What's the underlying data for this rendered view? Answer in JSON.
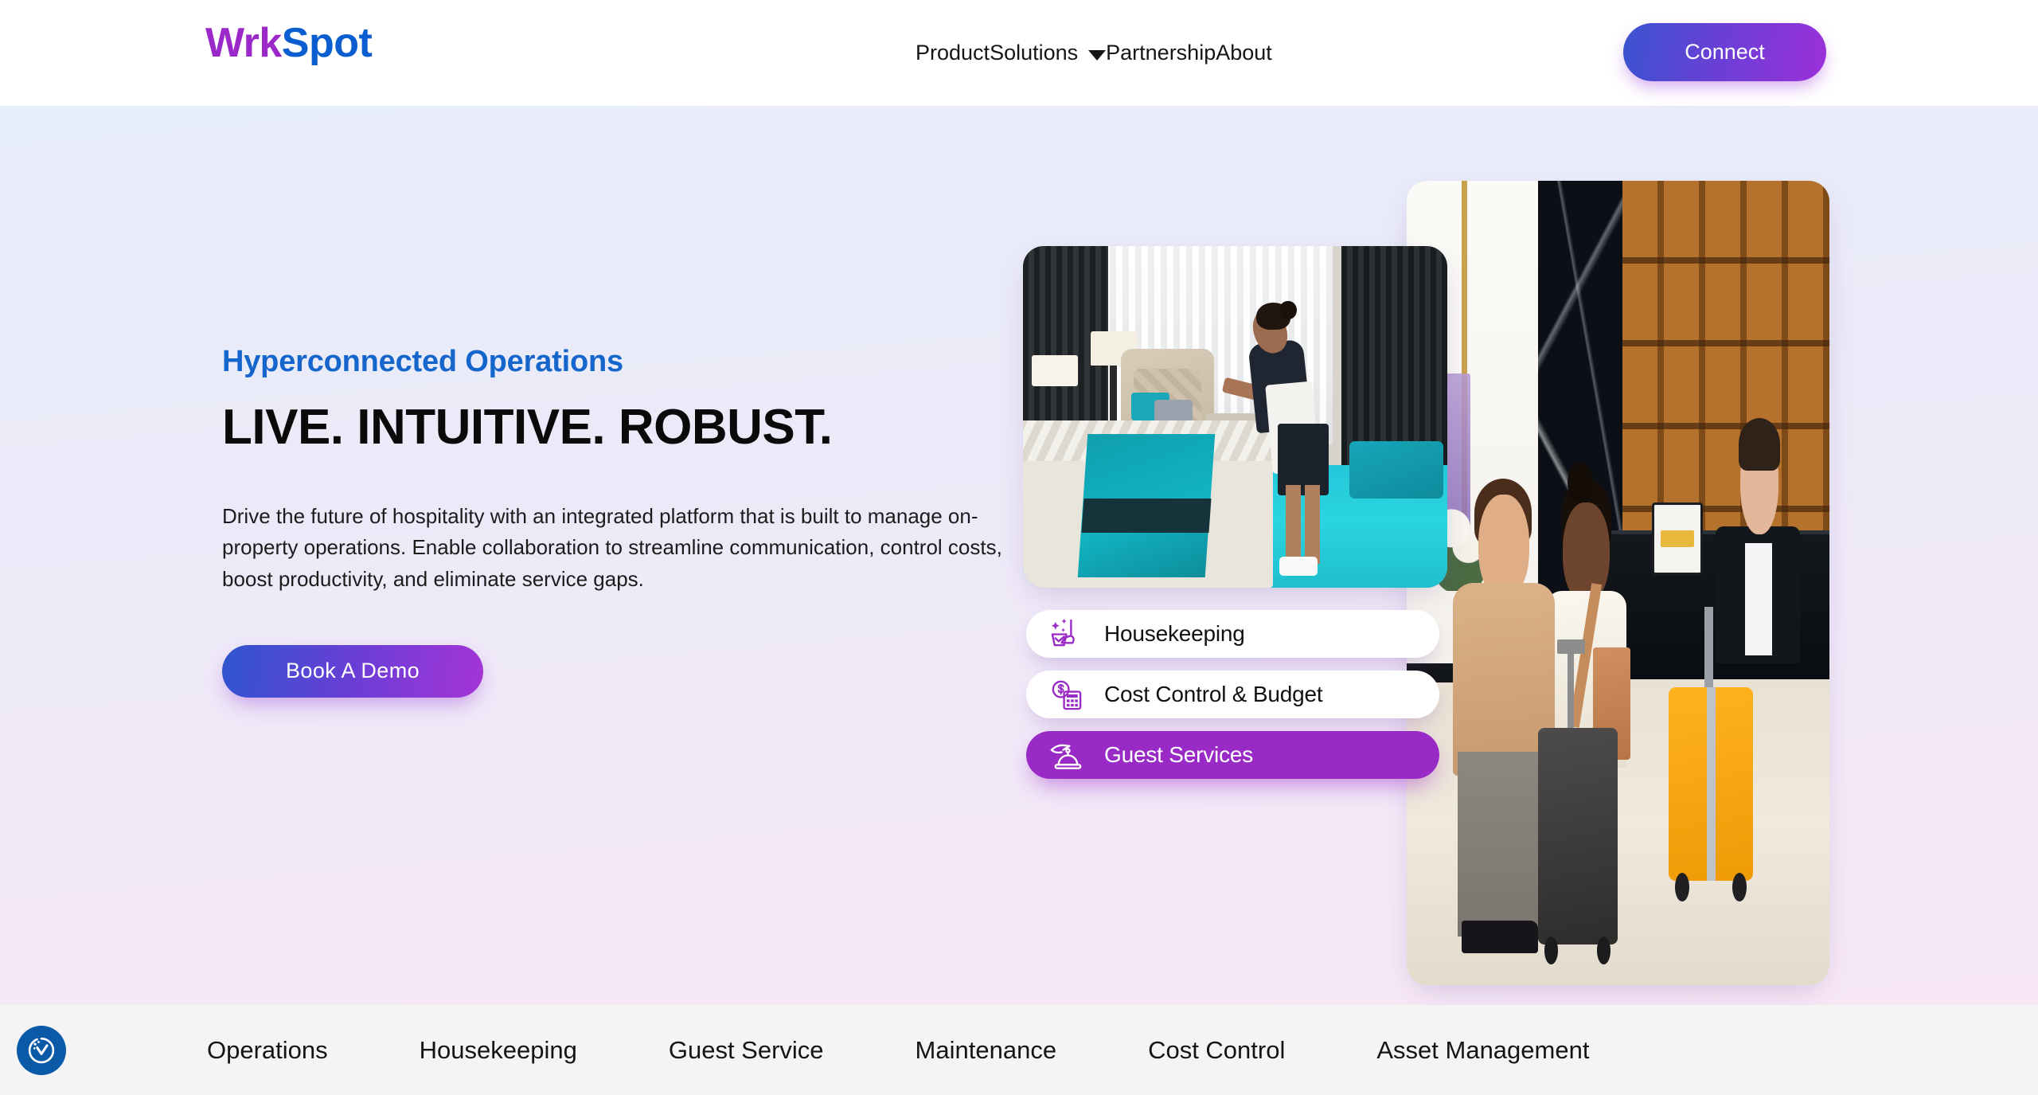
{
  "header": {
    "logo": {
      "part1": "Wrk",
      "part2": "Spot",
      "color1": "#9b28c8",
      "color2": "#0b5ed0"
    },
    "nav": [
      {
        "label": "Product",
        "has_dropdown": false
      },
      {
        "label": "Solutions",
        "has_dropdown": true
      },
      {
        "label": "Partnership",
        "has_dropdown": false
      },
      {
        "label": "About",
        "has_dropdown": false
      }
    ],
    "cta": {
      "label": "Connect",
      "gradient_from": "#3a54d0",
      "gradient_to": "#9b30d9"
    }
  },
  "hero": {
    "eyebrow": "Hyperconnected Operations",
    "eyebrow_color": "#1566cc",
    "headline": "LIVE. INTUITIVE. ROBUST.",
    "subcopy": "Drive the future of hospitality with an integrated platform that is built to manage on-property operations. Enable collaboration to streamline communication, control costs, boost productivity, and eliminate service gaps.",
    "cta": {
      "label": "Book A Demo",
      "gradient_from": "#2e55cf",
      "gradient_to": "#a534d6"
    },
    "background_from": "#e7edfa",
    "background_to": "#f8e8f6",
    "images": [
      {
        "name": "housekeeping-photo",
        "alt": "Hotel housekeeper making a bed in a guest room with teal bedding and carpet"
      },
      {
        "name": "lobby-photo",
        "alt": "Two guests with luggage checking in at a hotel front desk with a concierge"
      }
    ],
    "pills": [
      {
        "label": "Housekeeping",
        "icon": "broom-bucket-sparkle-icon",
        "active": false
      },
      {
        "label": "Cost Control & Budget",
        "icon": "coin-calculator-icon",
        "active": false
      },
      {
        "label": "Guest Services",
        "icon": "hand-service-bell-icon",
        "active": true
      }
    ],
    "pill_active_color": "#9a2ac6",
    "pill_icon_color": "#9a2ac6"
  },
  "bottom_bar": {
    "accessibility_icon": "accessibility-cookie-check-icon",
    "accessibility_color": "#0b5aa8",
    "items": [
      {
        "label": "Operations"
      },
      {
        "label": "Housekeeping"
      },
      {
        "label": "Guest Service"
      },
      {
        "label": "Maintenance"
      },
      {
        "label": "Cost Control"
      },
      {
        "label": "Asset Management"
      }
    ]
  }
}
